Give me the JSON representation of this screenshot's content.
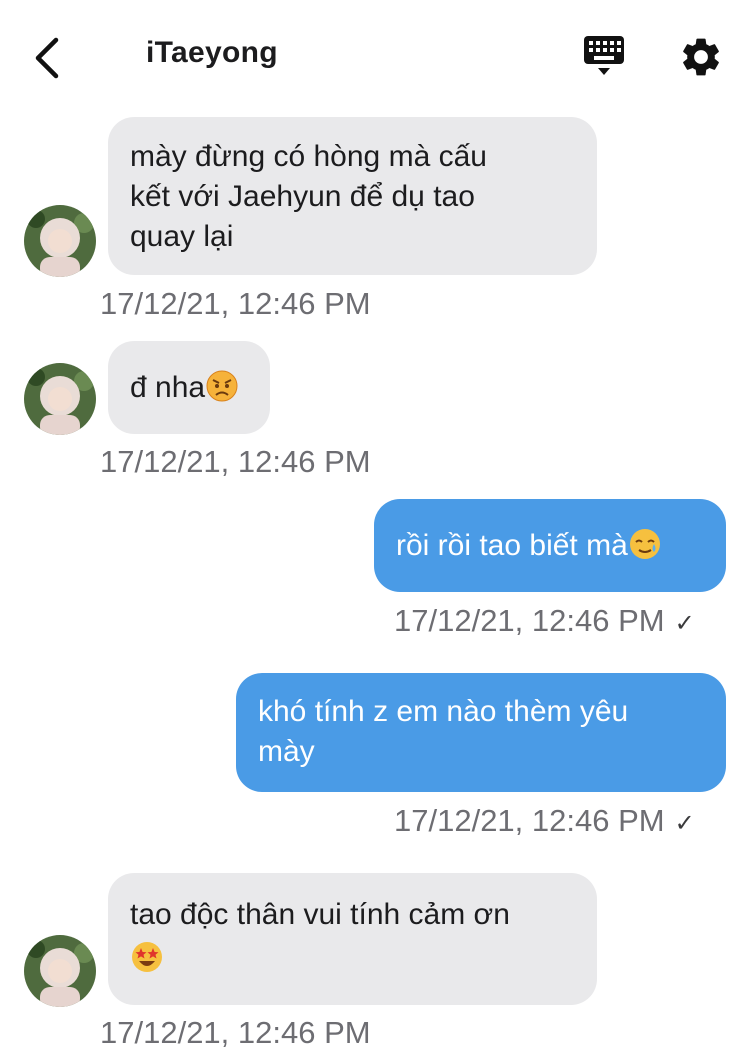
{
  "header": {
    "title": "iTaeyong",
    "back_icon": "chevron-left-icon",
    "keyboard_icon": "keyboard-icon",
    "settings_icon": "gear-icon"
  },
  "colors": {
    "incoming_bubble": "#e9e9eb",
    "outgoing_bubble": "#4a9be6",
    "timestamp": "#6d6d72"
  },
  "messages": [
    {
      "direction": "incoming",
      "lines": [
        "mày đừng có hòng mà cấu",
        "kết với Jaehyun để dụ tao",
        "quay lại"
      ],
      "timestamp": "17/12/21, 12:46 PM"
    },
    {
      "direction": "incoming",
      "text": "đ nha",
      "emoji": "angry-face",
      "timestamp": "17/12/21, 12:46 PM"
    },
    {
      "direction": "outgoing",
      "text": "rồi rồi tao biết mà",
      "emoji": "smiling-face-with-tear",
      "timestamp": "17/12/21, 12:46 PM",
      "status": "✓"
    },
    {
      "direction": "outgoing",
      "lines": [
        "khó tính z em nào thèm yêu",
        "mày"
      ],
      "timestamp": "17/12/21, 12:46 PM",
      "status": "✓"
    },
    {
      "direction": "incoming",
      "text": "tao độc thân vui tính cảm ơn",
      "emoji": "star-struck",
      "timestamp": "17/12/21, 12:46 PM"
    }
  ]
}
